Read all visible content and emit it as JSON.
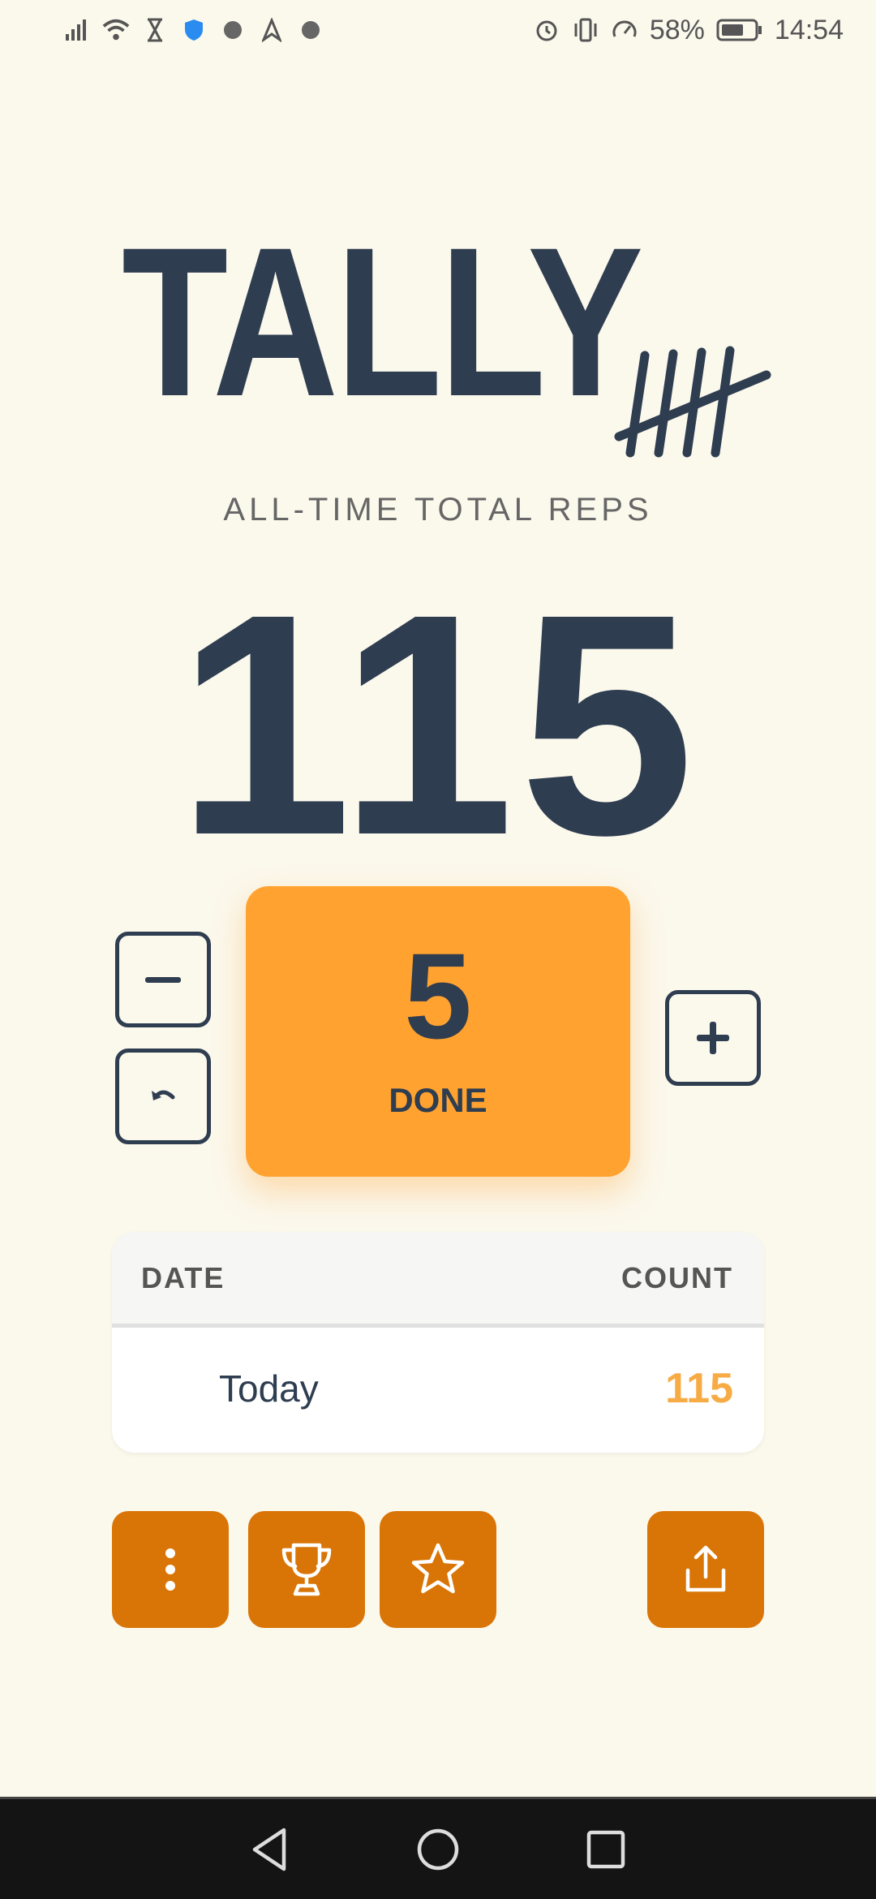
{
  "status_bar": {
    "battery": "58%",
    "time": "14:54",
    "icons_left": [
      "signal-icon",
      "wifi-icon",
      "hourglass-icon",
      "shield-icon",
      "notification-icon",
      "notification-icon",
      "notification-icon"
    ],
    "icons_right": [
      "alarm-icon",
      "vibrate-icon",
      "speedometer-icon",
      "battery-icon"
    ]
  },
  "logo": {
    "text": "TALLY",
    "icon": "tally-marks-icon"
  },
  "subtitle": "ALL-TIME TOTAL REPS",
  "total_reps": "115",
  "counter": {
    "decrement_icon": "minus-icon",
    "undo_icon": "undo-icon",
    "increment_icon": "plus-icon",
    "current_count": "5",
    "done_label": "DONE"
  },
  "history": {
    "headers": {
      "date": "DATE",
      "count": "COUNT"
    },
    "rows": [
      {
        "date": "Today",
        "count": "115"
      }
    ]
  },
  "actions": {
    "icons": [
      "more-vertical-icon",
      "trophy-icon",
      "star-icon",
      "share-icon"
    ]
  },
  "nav_bar": {
    "icons": [
      "back-icon",
      "home-icon",
      "recents-icon"
    ]
  },
  "colors": {
    "background": "#fbf8ec",
    "text_dark": "#2e3d50",
    "accent_orange": "#ffa22f",
    "action_orange": "#d97506",
    "count_orange": "#f7ab45"
  }
}
